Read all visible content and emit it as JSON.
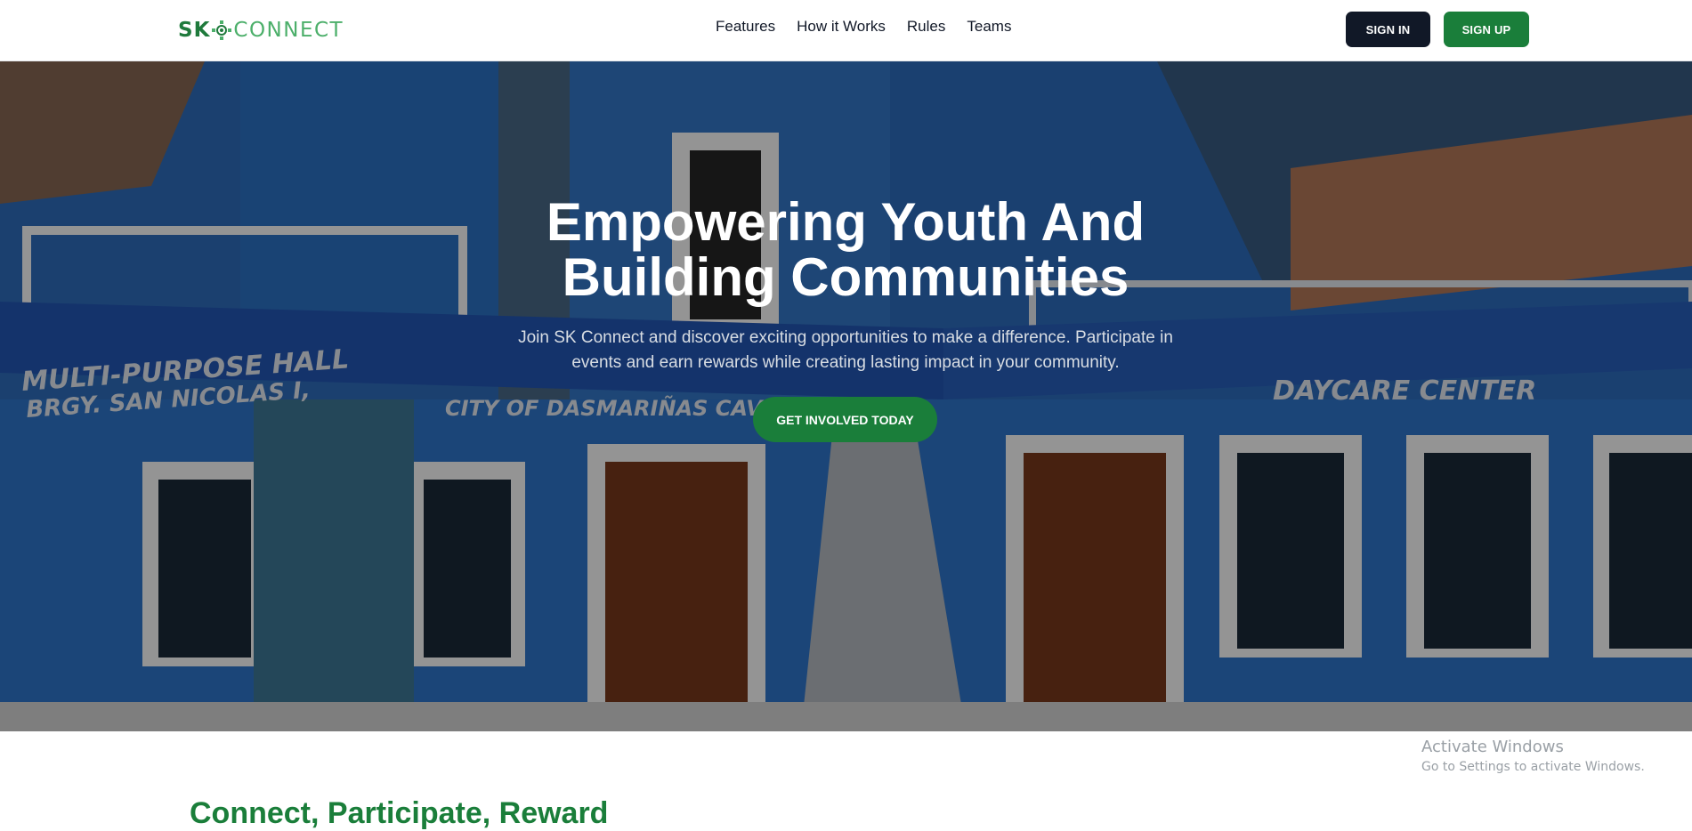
{
  "brand": {
    "logo_sk": "SK",
    "logo_connect": "CONNECT",
    "accent_green": "#1a7e3a",
    "dark": "#111827"
  },
  "nav": {
    "links": [
      "Features",
      "How it Works",
      "Rules",
      "Teams"
    ],
    "sign_in": "SIGN IN",
    "sign_up": "SIGN UP"
  },
  "hero": {
    "title_line1": "Empowering Youth And",
    "title_line2": "Building Communities",
    "subtitle": "Join SK Connect and discover exciting opportunities to make a difference. Participate in events and earn rewards while creating lasting impact in your community.",
    "cta": "GET INVOLVED TODAY",
    "background_signs": {
      "sign_left": "MULTI-PURPOSE HALL",
      "sign_left_2": "BRGY. SAN NICOLAS I,",
      "sign_center": "CITY OF DASMARIÑAS CAVITE",
      "sign_right": "DAYCARE CENTER"
    }
  },
  "section": {
    "heading": "Connect, Participate, Reward"
  },
  "os_watermark": {
    "title": "Activate Windows",
    "subtitle": "Go to Settings to activate Windows."
  }
}
